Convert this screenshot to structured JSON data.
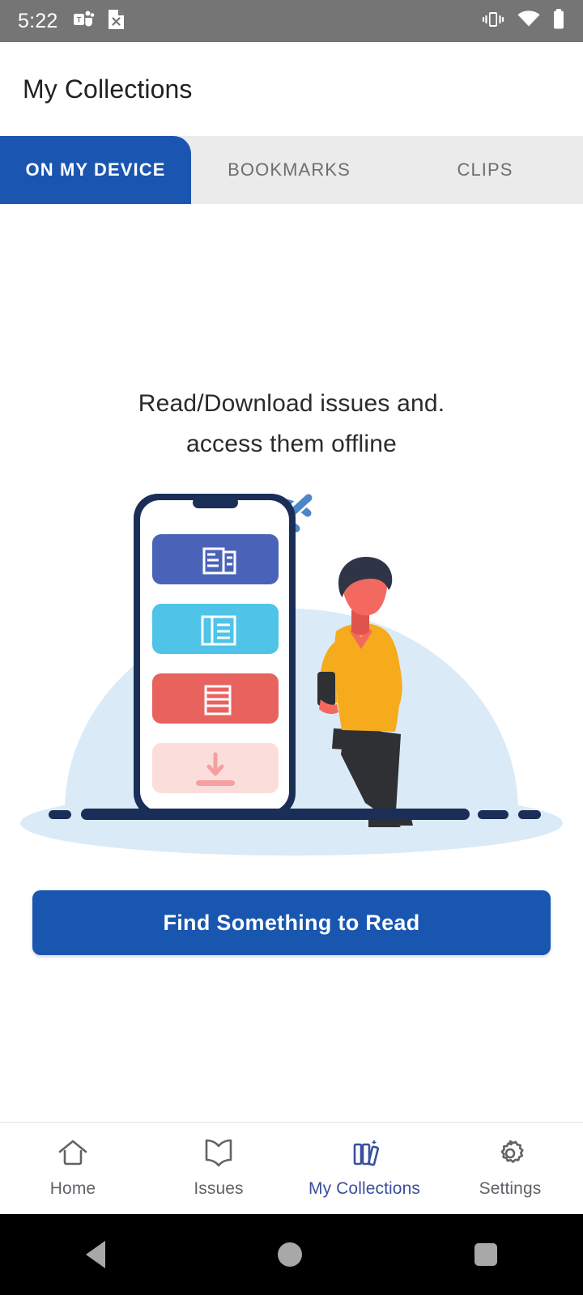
{
  "status_bar": {
    "time": "5:22",
    "left_icons": [
      "teams-icon",
      "document-x-icon"
    ],
    "right_icons": [
      "vibrate-icon",
      "wifi-icon",
      "battery-icon"
    ]
  },
  "app_bar": {
    "title": "My Collections"
  },
  "tabs": [
    {
      "label": "ON MY DEVICE",
      "active": true
    },
    {
      "label": "BOOKMARKS",
      "active": false
    },
    {
      "label": "CLIPS",
      "active": false
    }
  ],
  "empty_state": {
    "line1": "Read/Download issues and.",
    "line2": "access them offline",
    "illustration": "offline-reading-illustration",
    "cta_label": "Find Something to Read"
  },
  "bottom_nav": [
    {
      "label": "Home",
      "icon": "home-icon",
      "active": false
    },
    {
      "label": "Issues",
      "icon": "book-open-icon",
      "active": false
    },
    {
      "label": "My Collections",
      "icon": "books-stack-icon",
      "active": true
    },
    {
      "label": "Settings",
      "icon": "gear-icon",
      "active": false
    }
  ],
  "android_nav": {
    "back": "back-triangle",
    "home": "home-circle",
    "recents": "recents-square"
  },
  "colors": {
    "status_bar_bg": "#757575",
    "tab_active_bg": "#1a56b0",
    "tab_strip_bg": "#ebebeb",
    "cta_bg": "#1856b0",
    "nav_active": "#3a4f9e",
    "illus_backdrop": "#daeaf7",
    "card_blue": "#4a63b8",
    "card_cyan": "#4fc3e8",
    "card_red": "#e8625e",
    "card_pink": "#fbdedc",
    "sweater": "#f6ab1c",
    "skin": "#f4695f",
    "hair": "#2f3447",
    "pants": "#2e3033",
    "phone_frame": "#1b2e57",
    "wifi_off": "#4a86c8"
  }
}
